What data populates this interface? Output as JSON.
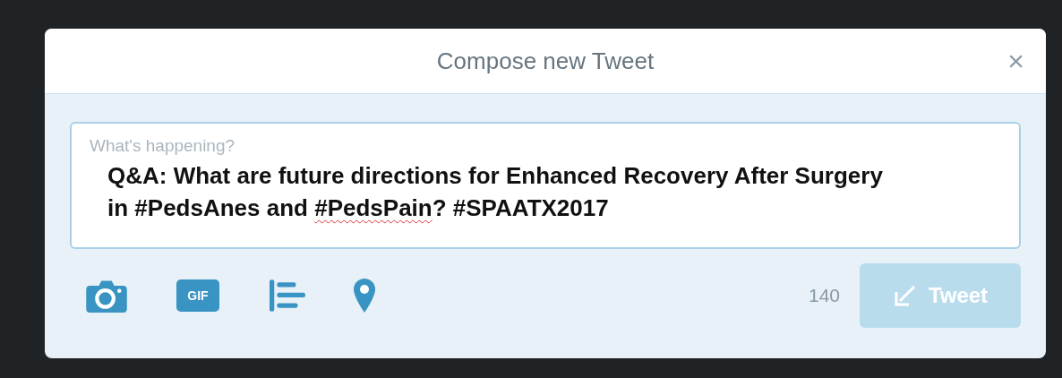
{
  "dialog": {
    "title": "Compose new Tweet",
    "close": "×"
  },
  "composer": {
    "placeholder": "What's happening?",
    "segments": [
      {
        "text": "Q&A: What are future directions for Enhanced Recovery After Surgery in #PedsAnes and ",
        "misspelled": false
      },
      {
        "text": "#PedsPain",
        "misspelled": true
      },
      {
        "text": "? #SPAATX2017",
        "misspelled": false
      }
    ]
  },
  "toolbar": [
    {
      "kind": "camera"
    },
    {
      "kind": "gif",
      "label": "GIF"
    },
    {
      "kind": "poll"
    },
    {
      "kind": "location"
    }
  ],
  "counter": "140",
  "tweet_button": {
    "label": "Tweet",
    "disabled": true
  }
}
